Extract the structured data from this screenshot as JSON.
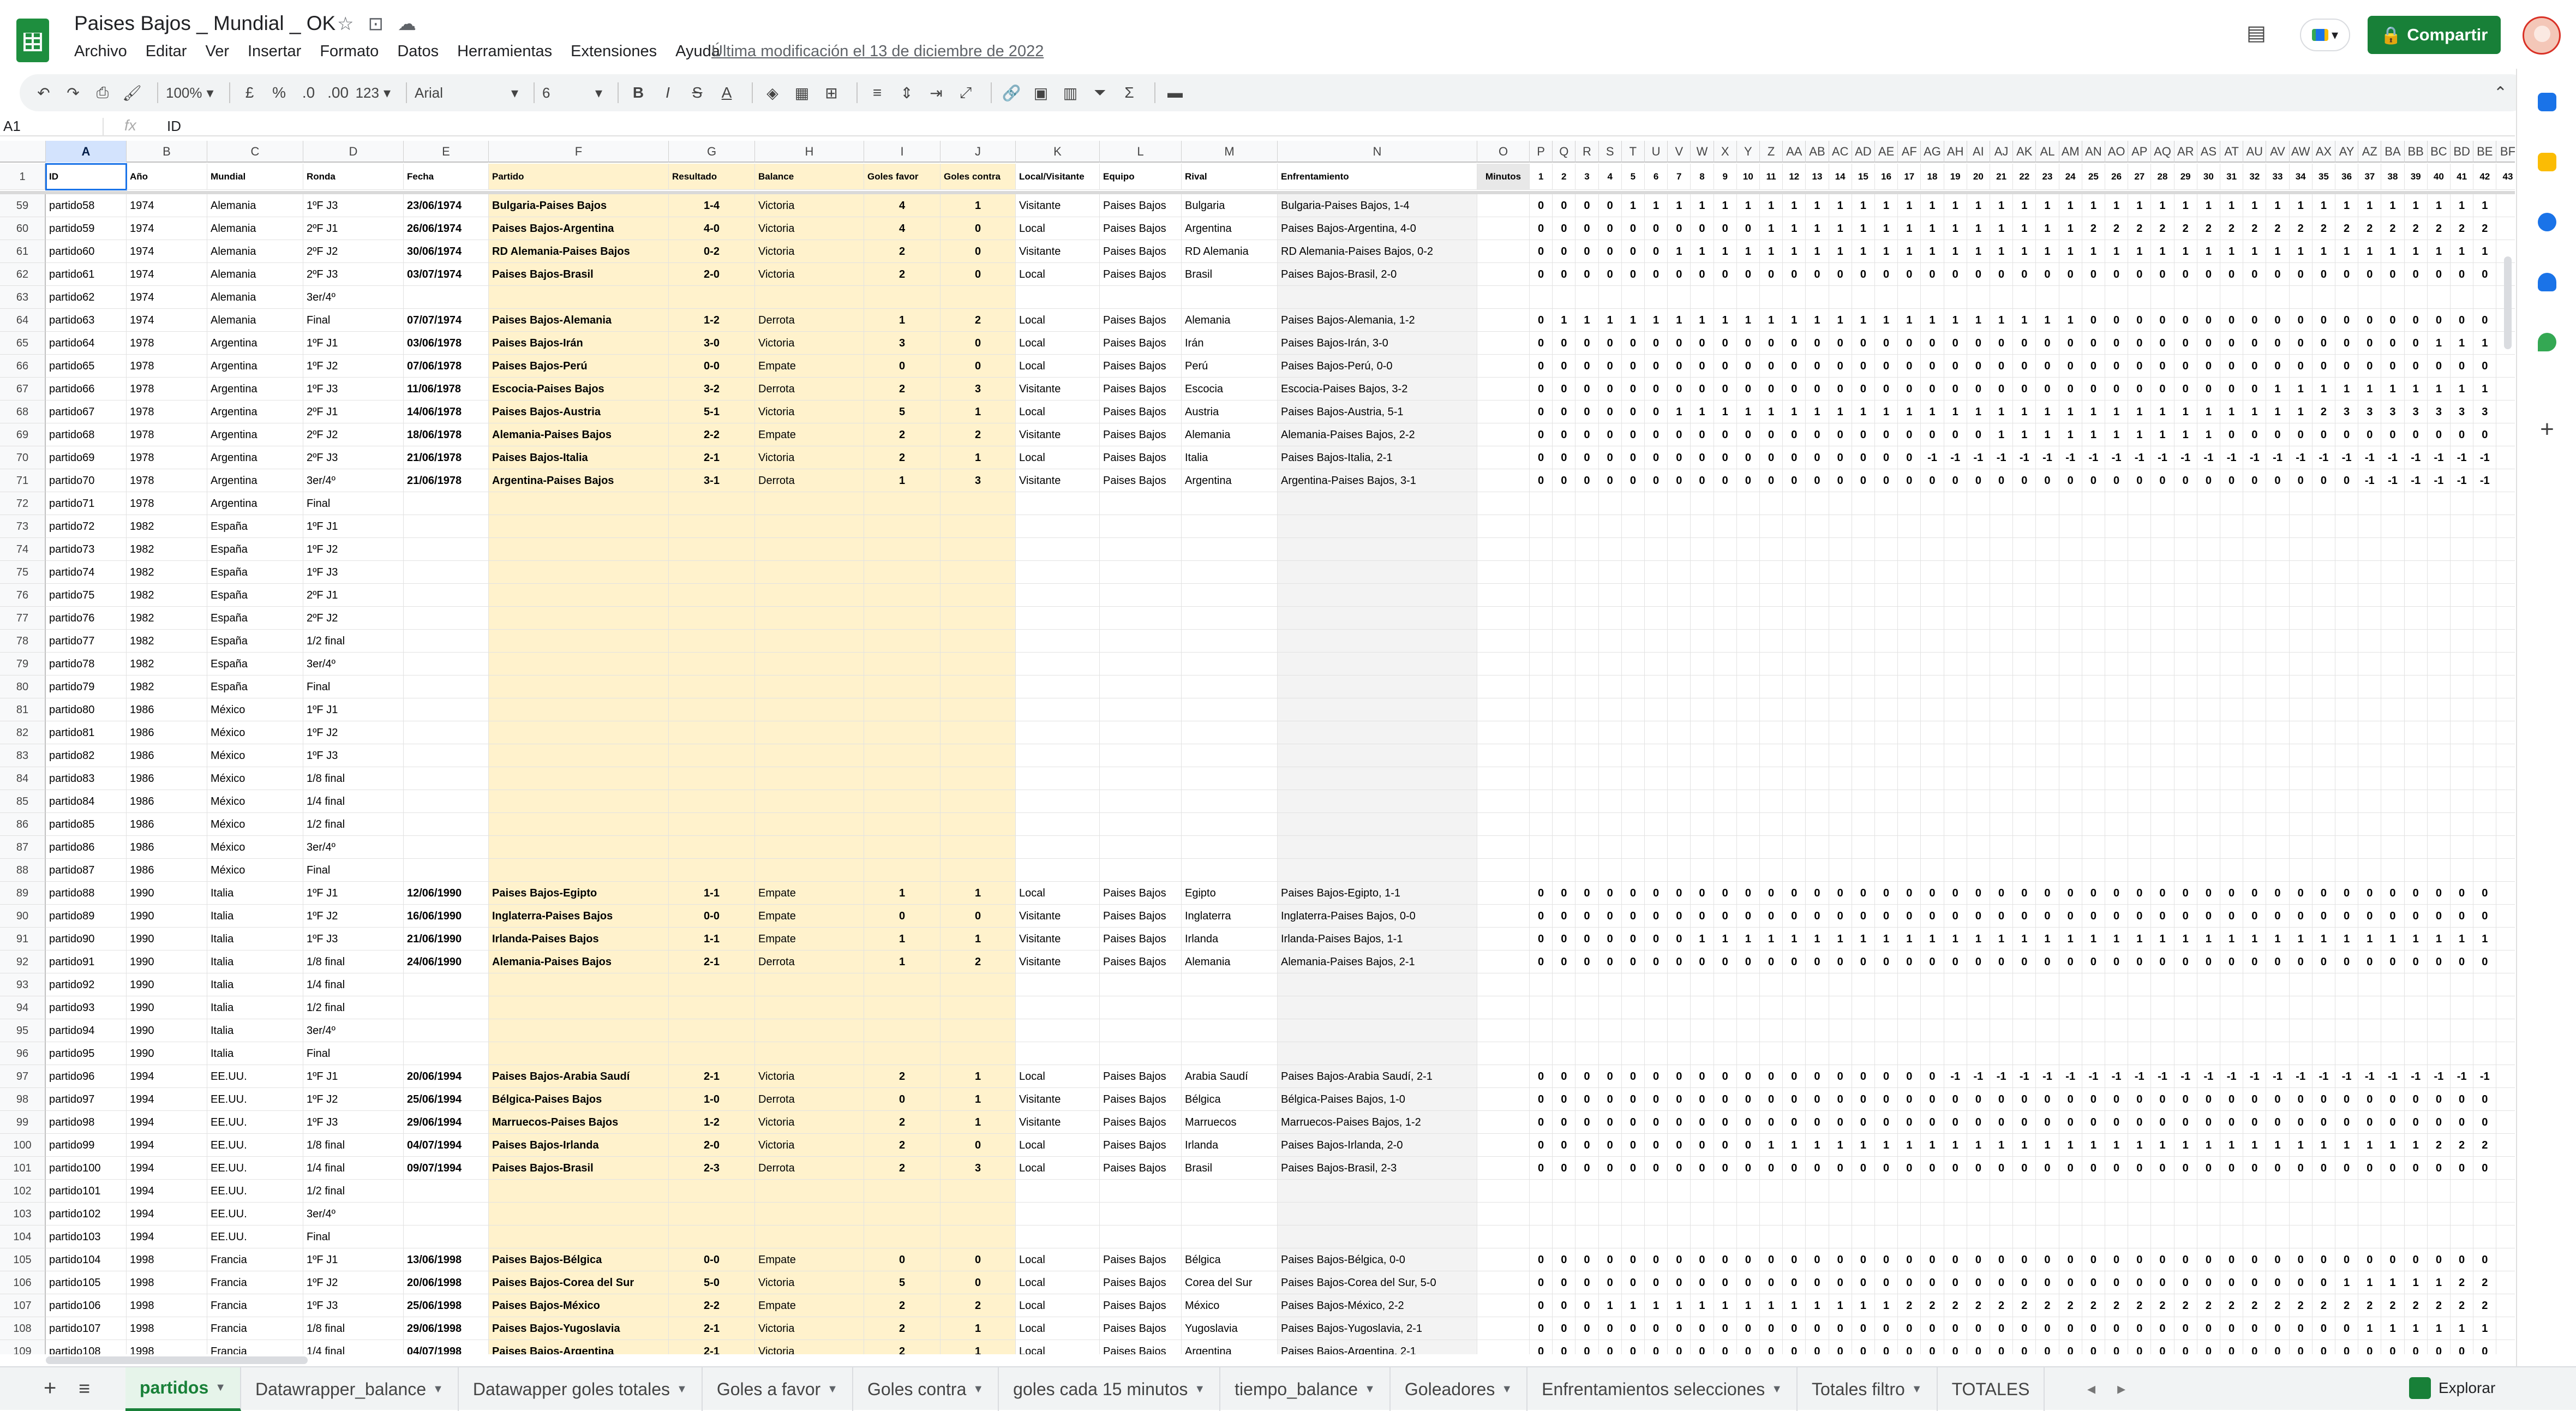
{
  "app": {
    "title": "Paises Bajos _ Mundial _ OK",
    "menu": [
      "Archivo",
      "Editar",
      "Ver",
      "Insertar",
      "Formato",
      "Datos",
      "Herramientas",
      "Extensiones",
      "Ayuda"
    ],
    "last_modified": "Última modificación el 13 de diciembre de 2022",
    "share_label": "Compartir"
  },
  "toolbar": {
    "zoom": "100%",
    "currency": "£",
    "percent": "%",
    "dec_less": ".0",
    "dec_more": ".00",
    "format_more": "123",
    "font": "Arial",
    "font_size": "6"
  },
  "formula_bar": {
    "cell_ref": "A1",
    "value": "ID"
  },
  "header_row": {
    "cells": [
      "ID",
      "Año",
      "Mundial",
      "Ronda",
      "Fecha",
      "Partido",
      "Resultado",
      "Balance",
      "Goles favor",
      "Goles contra",
      "Local/Visitante",
      "Equipo",
      "Rival",
      "Enfrentamiento",
      "Minutos"
    ],
    "minutes": [
      "1",
      "2",
      "3",
      "4",
      "5",
      "6",
      "7",
      "8",
      "9",
      "10",
      "11",
      "12",
      "13",
      "14",
      "15",
      "16",
      "17",
      "18",
      "19",
      "20",
      "21",
      "22",
      "23",
      "24",
      "25",
      "26",
      "27",
      "28",
      "29",
      "30",
      "31",
      "32",
      "33",
      "34",
      "35",
      "36",
      "37",
      "38",
      "39",
      "40",
      "41",
      "42",
      "43"
    ]
  },
  "columns_main": [
    "A",
    "B",
    "C",
    "D",
    "E",
    "F",
    "G",
    "H",
    "I",
    "J",
    "K",
    "L",
    "M",
    "N",
    "O"
  ],
  "columns_minutes": [
    "P",
    "Q",
    "R",
    "S",
    "T",
    "U",
    "V",
    "W",
    "X",
    "Y",
    "Z",
    "AA",
    "AB",
    "AC",
    "AD",
    "AE",
    "AF",
    "AG",
    "AH",
    "AI",
    "AJ",
    "AK",
    "AL",
    "AM",
    "AN",
    "AO",
    "AP",
    "AQ",
    "AR",
    "AS",
    "AT",
    "AU",
    "AV",
    "AW",
    "AX",
    "AY",
    "AZ",
    "BA",
    "BB",
    "BC",
    "BD",
    "BE",
    "BF"
  ],
  "rows": [
    {
      "n": "59",
      "c": [
        "partido58",
        "1974",
        "Alemania",
        "1ºF J3",
        "23/06/1974",
        "Bulgaria-Paises Bajos",
        "1-4",
        "Victoria",
        "4",
        "1",
        "Visitante",
        "Paises Bajos",
        "Bulgaria",
        "Bulgaria-Paises Bajos, 1-4"
      ],
      "m": "000011111111111111111111111111111111111111"
    },
    {
      "n": "60",
      "c": [
        "partido59",
        "1974",
        "Alemania",
        "2ºF J1",
        "26/06/1974",
        "Paises Bajos-Argentina",
        "4-0",
        "Victoria",
        "4",
        "0",
        "Local",
        "Paises Bajos",
        "Argentina",
        "Paises Bajos-Argentina, 4-0"
      ],
      "m": "000000000011111111111111222222222222222222"
    },
    {
      "n": "61",
      "c": [
        "partido60",
        "1974",
        "Alemania",
        "2ºF J2",
        "30/06/1974",
        "RD Alemania-Paises Bajos",
        "0-2",
        "Victoria",
        "2",
        "0",
        "Visitante",
        "Paises Bajos",
        "RD Alemania",
        "RD Alemania-Paises Bajos, 0-2"
      ],
      "m": "000000111111111111111111111111111111111111"
    },
    {
      "n": "62",
      "c": [
        "partido61",
        "1974",
        "Alemania",
        "2ºF J3",
        "03/07/1974",
        "Paises Bajos-Brasil",
        "2-0",
        "Victoria",
        "2",
        "0",
        "Local",
        "Paises Bajos",
        "Brasil",
        "Paises Bajos-Brasil, 2-0"
      ],
      "m": "000000000000000000000000000000000000000000"
    },
    {
      "n": "63",
      "c": [
        "partido62",
        "1974",
        "Alemania",
        "3er/4º",
        "",
        "",
        "",
        "",
        "",
        "",
        "",
        "",
        "",
        ""
      ],
      "m": ""
    },
    {
      "n": "64",
      "c": [
        "partido63",
        "1974",
        "Alemania",
        "Final",
        "07/07/1974",
        "Paises Bajos-Alemania",
        "1-2",
        "Derrota",
        "1",
        "2",
        "Local",
        "Paises Bajos",
        "Alemania",
        "Paises Bajos-Alemania, 1-2"
      ],
      "m": "011111111111111111111111000000000000000000"
    },
    {
      "n": "65",
      "c": [
        "partido64",
        "1978",
        "Argentina",
        "1ºF J1",
        "03/06/1978",
        "Paises Bajos-Irán",
        "3-0",
        "Victoria",
        "3",
        "0",
        "Local",
        "Paises Bajos",
        "Irán",
        "Paises Bajos-Irán, 3-0"
      ],
      "m": "000000000000000000000000000000000000000111"
    },
    {
      "n": "66",
      "c": [
        "partido65",
        "1978",
        "Argentina",
        "1ºF J2",
        "07/06/1978",
        "Paises Bajos-Perú",
        "0-0",
        "Empate",
        "0",
        "0",
        "Local",
        "Paises Bajos",
        "Perú",
        "Paises Bajos-Perú, 0-0"
      ],
      "m": "000000000000000000000000000000000000000000"
    },
    {
      "n": "67",
      "c": [
        "partido66",
        "1978",
        "Argentina",
        "1ºF J3",
        "11/06/1978",
        "Escocia-Paises Bajos",
        "3-2",
        "Derrota",
        "2",
        "3",
        "Visitante",
        "Paises Bajos",
        "Escocia",
        "Escocia-Paises Bajos, 3-2"
      ],
      "m": "000000000000000000000000000000001111111111"
    },
    {
      "n": "68",
      "c": [
        "partido67",
        "1978",
        "Argentina",
        "2ºF J1",
        "14/06/1978",
        "Paises Bajos-Austria",
        "5-1",
        "Victoria",
        "5",
        "1",
        "Local",
        "Paises Bajos",
        "Austria",
        "Paises Bajos-Austria, 5-1"
      ],
      "m": "000000111111111111111111111111111123333333"
    },
    {
      "n": "69",
      "c": [
        "partido68",
        "1978",
        "Argentina",
        "2ºF J2",
        "18/06/1978",
        "Alemania-Paises Bajos",
        "2-2",
        "Empate",
        "2",
        "2",
        "Visitante",
        "Paises Bajos",
        "Alemania",
        "Alemania-Paises Bajos, 2-2"
      ],
      "m": "000000000000000000001111111111000000000000"
    },
    {
      "n": "70",
      "c": [
        "partido69",
        "1978",
        "Argentina",
        "2ºF J3",
        "21/06/1978",
        "Paises Bajos-Italia",
        "2-1",
        "Victoria",
        "2",
        "1",
        "Local",
        "Paises Bajos",
        "Italia",
        "Paises Bajos-Italia, 2-1"
      ],
      "m": "00000000000000000-1-1-1-1-1-1-1-1-1-1-1-1-1-1-1-1-1-1-1-1-1-1-1-1-1"
    },
    {
      "n": "71",
      "c": [
        "partido70",
        "1978",
        "Argentina",
        "3er/4º",
        "21/06/1978",
        "Argentina-Paises Bajos",
        "3-1",
        "Derrota",
        "1",
        "3",
        "Visitante",
        "Paises Bajos",
        "Argentina",
        "Argentina-Paises Bajos, 3-1"
      ],
      "m": "000000000000000000000000000000000000-1-1-1-1-1-1"
    },
    {
      "n": "72",
      "c": [
        "partido71",
        "1978",
        "Argentina",
        "Final",
        "",
        "",
        "",
        "",
        "",
        "",
        "",
        "",
        "",
        ""
      ],
      "m": ""
    },
    {
      "n": "73",
      "c": [
        "partido72",
        "1982",
        "España",
        "1ºF J1",
        "",
        "",
        "",
        "",
        "",
        "",
        "",
        "",
        "",
        ""
      ],
      "m": ""
    },
    {
      "n": "74",
      "c": [
        "partido73",
        "1982",
        "España",
        "1ºF J2",
        "",
        "",
        "",
        "",
        "",
        "",
        "",
        "",
        "",
        ""
      ],
      "m": ""
    },
    {
      "n": "75",
      "c": [
        "partido74",
        "1982",
        "España",
        "1ºF J3",
        "",
        "",
        "",
        "",
        "",
        "",
        "",
        "",
        "",
        ""
      ],
      "m": ""
    },
    {
      "n": "76",
      "c": [
        "partido75",
        "1982",
        "España",
        "2ºF J1",
        "",
        "",
        "",
        "",
        "",
        "",
        "",
        "",
        "",
        ""
      ],
      "m": ""
    },
    {
      "n": "77",
      "c": [
        "partido76",
        "1982",
        "España",
        "2ºF J2",
        "",
        "",
        "",
        "",
        "",
        "",
        "",
        "",
        "",
        ""
      ],
      "m": ""
    },
    {
      "n": "78",
      "c": [
        "partido77",
        "1982",
        "España",
        "1/2 final",
        "",
        "",
        "",
        "",
        "",
        "",
        "",
        "",
        "",
        ""
      ],
      "m": ""
    },
    {
      "n": "79",
      "c": [
        "partido78",
        "1982",
        "España",
        "3er/4º",
        "",
        "",
        "",
        "",
        "",
        "",
        "",
        "",
        "",
        ""
      ],
      "m": ""
    },
    {
      "n": "80",
      "c": [
        "partido79",
        "1982",
        "España",
        "Final",
        "",
        "",
        "",
        "",
        "",
        "",
        "",
        "",
        "",
        ""
      ],
      "m": ""
    },
    {
      "n": "81",
      "c": [
        "partido80",
        "1986",
        "México",
        "1ºF J1",
        "",
        "",
        "",
        "",
        "",
        "",
        "",
        "",
        "",
        ""
      ],
      "m": ""
    },
    {
      "n": "82",
      "c": [
        "partido81",
        "1986",
        "México",
        "1ºF J2",
        "",
        "",
        "",
        "",
        "",
        "",
        "",
        "",
        "",
        ""
      ],
      "m": ""
    },
    {
      "n": "83",
      "c": [
        "partido82",
        "1986",
        "México",
        "1ºF J3",
        "",
        "",
        "",
        "",
        "",
        "",
        "",
        "",
        "",
        ""
      ],
      "m": ""
    },
    {
      "n": "84",
      "c": [
        "partido83",
        "1986",
        "México",
        "1/8 final",
        "",
        "",
        "",
        "",
        "",
        "",
        "",
        "",
        "",
        ""
      ],
      "m": ""
    },
    {
      "n": "85",
      "c": [
        "partido84",
        "1986",
        "México",
        "1/4 final",
        "",
        "",
        "",
        "",
        "",
        "",
        "",
        "",
        "",
        ""
      ],
      "m": ""
    },
    {
      "n": "86",
      "c": [
        "partido85",
        "1986",
        "México",
        "1/2 final",
        "",
        "",
        "",
        "",
        "",
        "",
        "",
        "",
        "",
        ""
      ],
      "m": ""
    },
    {
      "n": "87",
      "c": [
        "partido86",
        "1986",
        "México",
        "3er/4º",
        "",
        "",
        "",
        "",
        "",
        "",
        "",
        "",
        "",
        ""
      ],
      "m": ""
    },
    {
      "n": "88",
      "c": [
        "partido87",
        "1986",
        "México",
        "Final",
        "",
        "",
        "",
        "",
        "",
        "",
        "",
        "",
        "",
        ""
      ],
      "m": ""
    },
    {
      "n": "89",
      "c": [
        "partido88",
        "1990",
        "Italia",
        "1ºF J1",
        "12/06/1990",
        "Paises Bajos-Egipto",
        "1-1",
        "Empate",
        "1",
        "1",
        "Local",
        "Paises Bajos",
        "Egipto",
        "Paises Bajos-Egipto, 1-1"
      ],
      "m": "000000000000000000000000000000000000000000"
    },
    {
      "n": "90",
      "c": [
        "partido89",
        "1990",
        "Italia",
        "1ºF J2",
        "16/06/1990",
        "Inglaterra-Paises Bajos",
        "0-0",
        "Empate",
        "0",
        "0",
        "Visitante",
        "Paises Bajos",
        "Inglaterra",
        "Inglaterra-Paises Bajos, 0-0"
      ],
      "m": "000000000000000000000000000000000000000000"
    },
    {
      "n": "91",
      "c": [
        "partido90",
        "1990",
        "Italia",
        "1ºF J3",
        "21/06/1990",
        "Irlanda-Paises Bajos",
        "1-1",
        "Empate",
        "1",
        "1",
        "Visitante",
        "Paises Bajos",
        "Irlanda",
        "Irlanda-Paises Bajos, 1-1"
      ],
      "m": "000000011111111111111111111111111111111111"
    },
    {
      "n": "92",
      "c": [
        "partido91",
        "1990",
        "Italia",
        "1/8 final",
        "24/06/1990",
        "Alemania-Paises Bajos",
        "2-1",
        "Derrota",
        "1",
        "2",
        "Visitante",
        "Paises Bajos",
        "Alemania",
        "Alemania-Paises Bajos, 2-1"
      ],
      "m": "000000000000000000000000000000000000000000"
    },
    {
      "n": "93",
      "c": [
        "partido92",
        "1990",
        "Italia",
        "1/4 final",
        "",
        "",
        "",
        "",
        "",
        "",
        "",
        "",
        "",
        ""
      ],
      "m": ""
    },
    {
      "n": "94",
      "c": [
        "partido93",
        "1990",
        "Italia",
        "1/2 final",
        "",
        "",
        "",
        "",
        "",
        "",
        "",
        "",
        "",
        ""
      ],
      "m": ""
    },
    {
      "n": "95",
      "c": [
        "partido94",
        "1990",
        "Italia",
        "3er/4º",
        "",
        "",
        "",
        "",
        "",
        "",
        "",
        "",
        "",
        ""
      ],
      "m": ""
    },
    {
      "n": "96",
      "c": [
        "partido95",
        "1990",
        "Italia",
        "Final",
        "",
        "",
        "",
        "",
        "",
        "",
        "",
        "",
        "",
        ""
      ],
      "m": ""
    },
    {
      "n": "97",
      "c": [
        "partido96",
        "1994",
        "EE.UU.",
        "1ºF J1",
        "20/06/1994",
        "Paises Bajos-Arabia Saudí",
        "2-1",
        "Victoria",
        "2",
        "1",
        "Local",
        "Paises Bajos",
        "Arabia Saudí",
        "Paises Bajos-Arabia Saudí, 2-1"
      ],
      "m": "000000000000000000-1-1-1-1-1-1-1-1-1-1-1-1-1-1-1-1-1-1-1-1-1-1-1-1"
    },
    {
      "n": "98",
      "c": [
        "partido97",
        "1994",
        "EE.UU.",
        "1ºF J2",
        "25/06/1994",
        "Bélgica-Paises Bajos",
        "1-0",
        "Derrota",
        "0",
        "1",
        "Visitante",
        "Paises Bajos",
        "Bélgica",
        "Bélgica-Paises Bajos, 1-0"
      ],
      "m": "000000000000000000000000000000000000000000"
    },
    {
      "n": "99",
      "c": [
        "partido98",
        "1994",
        "EE.UU.",
        "1ºF J3",
        "29/06/1994",
        "Marruecos-Paises Bajos",
        "1-2",
        "Victoria",
        "2",
        "1",
        "Visitante",
        "Paises Bajos",
        "Marruecos",
        "Marruecos-Paises Bajos, 1-2"
      ],
      "m": "000000000000000000000000000000000000000000"
    },
    {
      "n": "100",
      "c": [
        "partido99",
        "1994",
        "EE.UU.",
        "1/8 final",
        "04/07/1994",
        "Paises Bajos-Irlanda",
        "2-0",
        "Victoria",
        "2",
        "0",
        "Local",
        "Paises Bajos",
        "Irlanda",
        "Paises Bajos-Irlanda, 2-0"
      ],
      "m": "000000000011111111111111111111111111111222"
    },
    {
      "n": "101",
      "c": [
        "partido100",
        "1994",
        "EE.UU.",
        "1/4 final",
        "09/07/1994",
        "Paises Bajos-Brasil",
        "2-3",
        "Derrota",
        "2",
        "3",
        "Local",
        "Paises Bajos",
        "Brasil",
        "Paises Bajos-Brasil, 2-3"
      ],
      "m": "000000000000000000000000000000000000000000"
    },
    {
      "n": "102",
      "c": [
        "partido101",
        "1994",
        "EE.UU.",
        "1/2 final",
        "",
        "",
        "",
        "",
        "",
        "",
        "",
        "",
        "",
        ""
      ],
      "m": ""
    },
    {
      "n": "103",
      "c": [
        "partido102",
        "1994",
        "EE.UU.",
        "3er/4º",
        "",
        "",
        "",
        "",
        "",
        "",
        "",
        "",
        "",
        ""
      ],
      "m": ""
    },
    {
      "n": "104",
      "c": [
        "partido103",
        "1994",
        "EE.UU.",
        "Final",
        "",
        "",
        "",
        "",
        "",
        "",
        "",
        "",
        "",
        ""
      ],
      "m": ""
    },
    {
      "n": "105",
      "c": [
        "partido104",
        "1998",
        "Francia",
        "1ºF J1",
        "13/06/1998",
        "Paises Bajos-Bélgica",
        "0-0",
        "Empate",
        "0",
        "0",
        "Local",
        "Paises Bajos",
        "Bélgica",
        "Paises Bajos-Bélgica, 0-0"
      ],
      "m": "000000000000000000000000000000000000000000"
    },
    {
      "n": "106",
      "c": [
        "partido105",
        "1998",
        "Francia",
        "1ºF J2",
        "20/06/1998",
        "Paises Bajos-Corea del Sur",
        "5-0",
        "Victoria",
        "5",
        "0",
        "Local",
        "Paises Bajos",
        "Corea del Sur",
        "Paises Bajos-Corea del Sur, 5-0"
      ],
      "m": "000000000000000000000000000000000001111122"
    },
    {
      "n": "107",
      "c": [
        "partido106",
        "1998",
        "Francia",
        "1ºF J3",
        "25/06/1998",
        "Paises Bajos-México",
        "2-2",
        "Empate",
        "2",
        "2",
        "Local",
        "Paises Bajos",
        "México",
        "Paises Bajos-México, 2-2"
      ],
      "m": "000111111111111122222222222222222222222222"
    },
    {
      "n": "108",
      "c": [
        "partido107",
        "1998",
        "Francia",
        "1/8 final",
        "29/06/1998",
        "Paises Bajos-Yugoslavia",
        "2-1",
        "Victoria",
        "2",
        "1",
        "Local",
        "Paises Bajos",
        "Yugoslavia",
        "Paises Bajos-Yugoslavia, 2-1"
      ],
      "m": "000000000000000000000000000000000000111111"
    },
    {
      "n": "109",
      "c": [
        "partido108",
        "1998",
        "Francia",
        "1/4 final",
        "04/07/1998",
        "Paises Bajos-Argentina",
        "2-1",
        "Victoria",
        "2",
        "1",
        "Local",
        "Paises Bajos",
        "Argentina",
        "Paises Bajos-Argentina, 2-1"
      ],
      "m": "000000000000000000000000000000000000000000"
    }
  ],
  "tabs": [
    {
      "label": "partidos",
      "active": true
    },
    {
      "label": "Datawrapper_balance"
    },
    {
      "label": "Datawapper goles totales"
    },
    {
      "label": "Goles a favor"
    },
    {
      "label": "Goles contra"
    },
    {
      "label": "goles cada 15 minutos"
    },
    {
      "label": "tiempo_balance"
    },
    {
      "label": "Goleadores"
    },
    {
      "label": "Enfrentamientos selecciones"
    },
    {
      "label": "Totales filtro"
    },
    {
      "label": "TOTALES"
    }
  ],
  "explore_label": "Explorar",
  "colors": {
    "accent": "#188038",
    "selected": "#1a73e8",
    "highlight": "#fff2cc"
  }
}
